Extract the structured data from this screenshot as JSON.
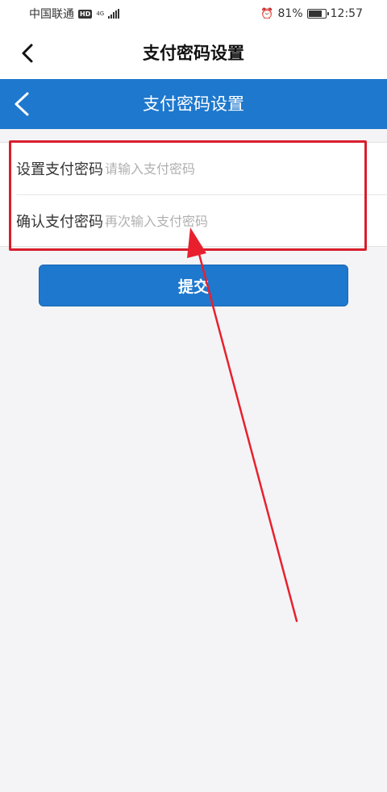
{
  "status_bar": {
    "carrier": "中国联通",
    "hd_badge": "HD",
    "network_type": "4G",
    "battery_percent": "81%",
    "battery_level": 0.81,
    "time": "12:57"
  },
  "top_nav": {
    "title": "支付密码设置"
  },
  "header": {
    "title": "支付密码设置"
  },
  "form": {
    "set_password_label": "设置支付密码",
    "set_password_placeholder": "请输入支付密码",
    "set_password_value": "",
    "confirm_password_label": "确认支付密码",
    "confirm_password_placeholder": "再次输入支付密码",
    "confirm_password_value": ""
  },
  "submit_label": "提交",
  "colors": {
    "brand_blue": "#1e78cd",
    "highlight_red": "#d81e2c",
    "placeholder_gray": "#b0b0b0"
  },
  "icons": {
    "nav_back": "chevron-left-icon",
    "header_back": "chevron-left-icon",
    "alarm": "alarm-icon",
    "signal": "signal-icon",
    "battery": "battery-icon"
  }
}
